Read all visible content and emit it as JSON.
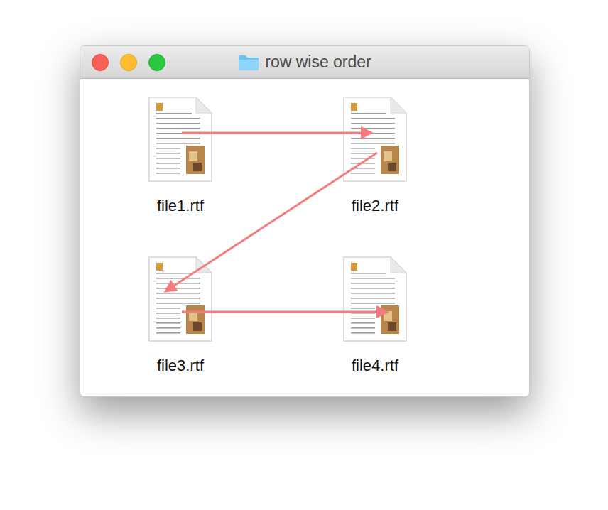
{
  "window": {
    "title": "row wise order"
  },
  "files": [
    {
      "name": "file1.rtf"
    },
    {
      "name": "file2.rtf"
    },
    {
      "name": "file3.rtf"
    },
    {
      "name": "file4.rtf"
    }
  ],
  "arrows": [
    {
      "from": "file1.rtf",
      "to": "file2.rtf",
      "color": "#f47c7c"
    },
    {
      "from": "file2.rtf",
      "to": "file3.rtf",
      "color": "#f47c7c"
    },
    {
      "from": "file3.rtf",
      "to": "file4.rtf",
      "color": "#f47c7c"
    }
  ]
}
